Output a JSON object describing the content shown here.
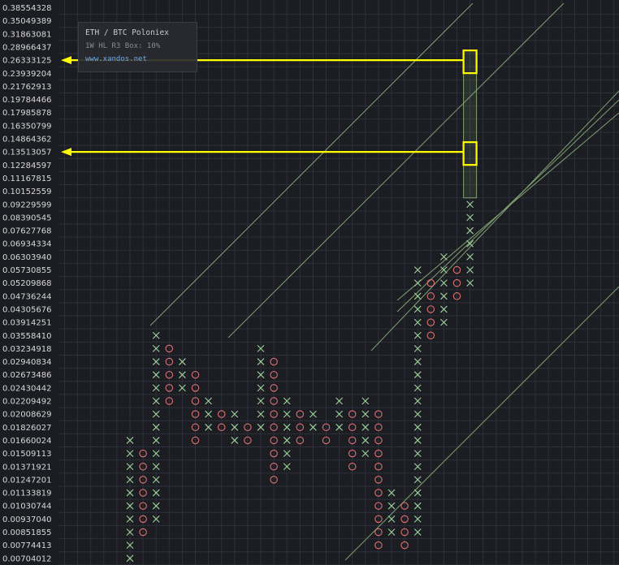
{
  "legend": {
    "title": "ETH / BTC Poloniex",
    "subtitle": "1W HL R3 Box: 10%",
    "url": "www.xandos.net"
  },
  "colors": {
    "background": "#1b1d22",
    "grid": "#2e313a",
    "x_mark": "#9fd39a",
    "o_mark": "#e07070",
    "trendline": "#7fa070",
    "highlight": "#ffff00"
  },
  "chart_data": {
    "type": "point-and-figure",
    "ylabel_ticks": [
      "0.38554328",
      "0.35049389",
      "0.31863081",
      "0.28966437",
      "0.26333125",
      "0.23939204",
      "0.21762913",
      "0.19784466",
      "0.17985878",
      "0.16350799",
      "0.14864362",
      "0.13513057",
      "0.12284597",
      "0.11167815",
      "0.10152559",
      "0.09229599",
      "0.08390545",
      "0.07627768",
      "0.06934334",
      "0.06303940",
      "0.05730855",
      "0.05209868",
      "0.04736244",
      "0.04305676",
      "0.03914251",
      "0.03558410",
      "0.03234918",
      "0.02940834",
      "0.02673486",
      "0.02430442",
      "0.02209492",
      "0.02008629",
      "0.01826027",
      "0.01660024",
      "0.01509113",
      "0.01371921",
      "0.01247201",
      "0.01133819",
      "0.01030744",
      "0.00937040",
      "0.00851855",
      "0.00774413",
      "0.00704012"
    ],
    "box_size": "10%",
    "reversal": 3,
    "columns": [
      {
        "type": "X",
        "from": "0.00704012",
        "to": "0.01660024"
      },
      {
        "type": "O",
        "from": "0.01509113",
        "to": "0.00851855"
      },
      {
        "type": "X",
        "from": "0.00937040",
        "to": "0.03558410"
      },
      {
        "type": "O",
        "from": "0.03234918",
        "to": "0.02209492"
      },
      {
        "type": "X",
        "from": "0.02430442",
        "to": "0.02940834"
      },
      {
        "type": "O",
        "from": "0.02673486",
        "to": "0.01660024"
      },
      {
        "type": "X",
        "from": "0.01826027",
        "to": "0.02209492"
      },
      {
        "type": "O",
        "from": "0.02008629",
        "to": "0.01826027"
      },
      {
        "type": "X",
        "from": "0.01660024",
        "to": "0.02008629"
      },
      {
        "type": "O",
        "from": "0.01826027",
        "to": "0.01660024"
      },
      {
        "type": "X",
        "from": "0.01826027",
        "to": "0.03234918"
      },
      {
        "type": "O",
        "from": "0.02940834",
        "to": "0.01247201"
      },
      {
        "type": "X",
        "from": "0.01371921",
        "to": "0.02209492"
      },
      {
        "type": "O",
        "from": "0.02008629",
        "to": "0.01660024"
      },
      {
        "type": "X",
        "from": "0.01826027",
        "to": "0.02008629"
      },
      {
        "type": "O",
        "from": "0.01826027",
        "to": "0.01660024"
      },
      {
        "type": "X",
        "from": "0.01826027",
        "to": "0.02209492"
      },
      {
        "type": "O",
        "from": "0.02008629",
        "to": "0.01371921"
      },
      {
        "type": "X",
        "from": "0.01509113",
        "to": "0.02209492"
      },
      {
        "type": "O",
        "from": "0.02008629",
        "to": "0.00774413"
      },
      {
        "type": "X",
        "from": "0.00851855",
        "to": "0.01133819"
      },
      {
        "type": "O",
        "from": "0.01030744",
        "to": "0.00774413"
      },
      {
        "type": "X",
        "from": "0.00851855",
        "to": "0.05730855"
      },
      {
        "type": "O",
        "from": "0.05209868",
        "to": "0.03558410"
      },
      {
        "type": "X",
        "from": "0.03914251",
        "to": "0.06303940"
      },
      {
        "type": "O",
        "from": "0.05730855",
        "to": "0.04736244"
      },
      {
        "type": "X",
        "from": "0.05209868",
        "to": "0.09229599"
      }
    ],
    "highlight_targets": [
      "0.26333125",
      "0.13513057"
    ]
  }
}
